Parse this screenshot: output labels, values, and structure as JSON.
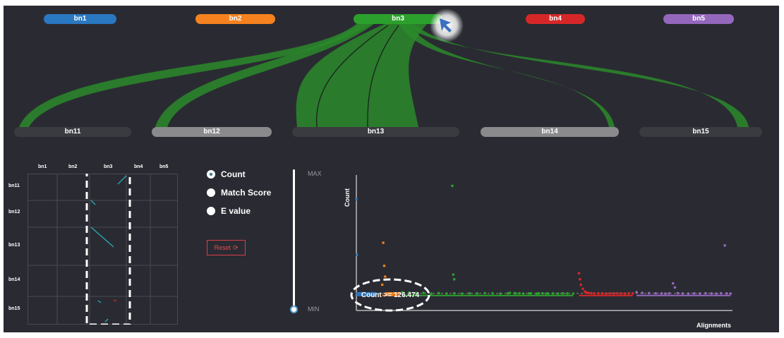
{
  "top_nodes": [
    {
      "label": "bn1",
      "color": "#2b78c2"
    },
    {
      "label": "bn2",
      "color": "#f5821f"
    },
    {
      "label": "bn3",
      "color": "#2ca02c"
    },
    {
      "label": "bn4",
      "color": "#d62728"
    },
    {
      "label": "bn5",
      "color": "#9467bd"
    }
  ],
  "bottom_nodes": [
    {
      "label": "bn11",
      "color": "#3a3b40"
    },
    {
      "label": "bn12",
      "color": "#8a8a8c"
    },
    {
      "label": "bn13",
      "color": "#3a3b40"
    },
    {
      "label": "bn14",
      "color": "#8a8a8c"
    },
    {
      "label": "bn15",
      "color": "#3a3b40"
    }
  ],
  "ribbon_color": "#2a8a2a",
  "matrix": {
    "col_labels": [
      "bn1",
      "bn2",
      "bn3",
      "bn4",
      "bn5"
    ],
    "row_labels": [
      "bn11",
      "bn12",
      "bn13",
      "bn14",
      "bn15"
    ]
  },
  "metric": {
    "options": [
      "Count",
      "Match Score",
      "E value"
    ],
    "selected": "Count",
    "reset_label": "Reset",
    "reset_icon": "refresh-icon",
    "reset_color": "#d93f45"
  },
  "slider": {
    "max_label": "MAX",
    "min_label": "MIN",
    "level": 0
  },
  "chart_data": {
    "type": "scatter",
    "ylabel": "Count",
    "xlabel": "Alignments",
    "threshold_label": "Count >= 126.474",
    "threshold": 126.474,
    "series": [
      {
        "color": "#2b78c2",
        "points": [
          [
            0,
            820
          ],
          [
            0.6,
            410
          ],
          [
            1,
            126
          ],
          [
            2,
            125
          ],
          [
            3,
            127
          ],
          [
            4,
            126
          ],
          [
            5,
            128
          ],
          [
            6,
            125
          ],
          [
            7,
            127
          ],
          [
            8,
            126
          ],
          [
            9,
            125
          ],
          [
            10,
            127
          ],
          [
            11,
            126
          ],
          [
            12,
            125
          ],
          [
            13,
            127
          ],
          [
            14,
            126
          ],
          [
            15,
            127
          ],
          [
            16,
            126
          ],
          [
            17,
            128
          ],
          [
            18,
            126
          ],
          [
            19,
            125
          ],
          [
            20,
            127
          ]
        ]
      },
      {
        "color": "#f5821f",
        "points": [
          [
            28,
            500
          ],
          [
            29,
            330
          ],
          [
            30,
            250
          ],
          [
            27,
            190
          ],
          [
            31,
            126
          ],
          [
            32,
            125
          ],
          [
            33,
            127
          ],
          [
            34,
            126
          ],
          [
            35,
            125
          ],
          [
            36,
            127
          ],
          [
            37,
            126
          ],
          [
            38,
            125
          ],
          [
            39,
            127
          ],
          [
            40,
            126
          ],
          [
            41,
            127
          ],
          [
            42,
            126
          ],
          [
            43,
            125
          ],
          [
            44,
            127
          ]
        ]
      },
      {
        "color": "#2ca02c",
        "points": [
          [
            48,
            135
          ],
          [
            55,
            132
          ],
          [
            62,
            128
          ],
          [
            70,
            130
          ],
          [
            78,
            125
          ],
          [
            86,
            128
          ],
          [
            94,
            126
          ],
          [
            102,
            127
          ],
          [
            110,
            125
          ],
          [
            118,
            127
          ],
          [
            126,
            126
          ],
          [
            134,
            128
          ],
          [
            142,
            127
          ],
          [
            150,
            125
          ],
          [
            158,
            127
          ],
          [
            166,
            126
          ],
          [
            174,
            125
          ],
          [
            182,
            127
          ],
          [
            190,
            126
          ],
          [
            198,
            125
          ],
          [
            205,
            126
          ],
          [
            100,
            920
          ],
          [
            101,
            265
          ],
          [
            102,
            230
          ],
          [
            160,
            130
          ],
          [
            165,
            128
          ],
          [
            170,
            127
          ],
          [
            180,
            126
          ],
          [
            188,
            125
          ],
          [
            194,
            127
          ],
          [
            200,
            126
          ],
          [
            210,
            125
          ],
          [
            215,
            127
          ],
          [
            220,
            126
          ],
          [
            226,
            125
          ]
        ]
      },
      {
        "color": "#d62728",
        "points": [
          [
            232,
            275
          ],
          [
            233,
            230
          ],
          [
            234,
            190
          ],
          [
            236,
            160
          ],
          [
            238,
            140
          ],
          [
            240,
            132
          ],
          [
            242,
            130
          ],
          [
            245,
            128
          ],
          [
            248,
            126
          ],
          [
            252,
            127
          ],
          [
            256,
            126
          ],
          [
            260,
            125
          ],
          [
            264,
            127
          ],
          [
            268,
            126
          ],
          [
            272,
            127
          ],
          [
            276,
            126
          ],
          [
            280,
            125
          ],
          [
            284,
            127
          ],
          [
            288,
            126
          ]
        ]
      },
      {
        "color": "#9467bd",
        "points": [
          [
            292,
            135
          ],
          [
            298,
            130
          ],
          [
            305,
            128
          ],
          [
            312,
            127
          ],
          [
            318,
            126
          ],
          [
            322,
            125
          ],
          [
            326,
            127
          ],
          [
            330,
            200
          ],
          [
            332,
            170
          ],
          [
            335,
            128
          ],
          [
            340,
            126
          ],
          [
            346,
            125
          ],
          [
            352,
            127
          ],
          [
            358,
            126
          ],
          [
            364,
            127
          ],
          [
            370,
            126
          ],
          [
            375,
            125
          ],
          [
            380,
            127
          ],
          [
            384,
            480
          ],
          [
            386,
            126
          ],
          [
            390,
            125
          ]
        ]
      }
    ],
    "xlim": [
      0,
      392
    ],
    "ylim": [
      0,
      1000
    ]
  }
}
